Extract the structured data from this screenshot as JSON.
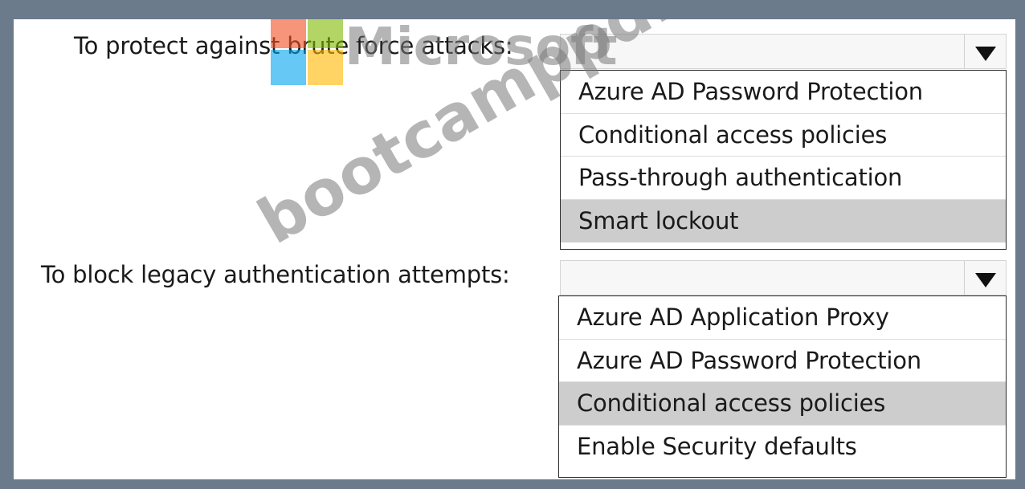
{
  "questions": [
    {
      "label": "To protect against brute force attacks:",
      "options": [
        "Azure AD Password Protection",
        "Conditional access policies",
        "Pass-through authentication",
        "Smart lockout"
      ],
      "selected_index": 3
    },
    {
      "label": "To block legacy authentication attempts:",
      "options": [
        "Azure AD Application Proxy",
        "Azure AD Password Protection",
        "Conditional access policies",
        "Enable Security defaults"
      ],
      "selected_index": 2
    }
  ],
  "watermark": {
    "brand": "Microsoft",
    "site": "bootcamppdf.com",
    "logo_colors": [
      "#f25022",
      "#7fba00",
      "#00a4ef",
      "#ffb900"
    ]
  }
}
